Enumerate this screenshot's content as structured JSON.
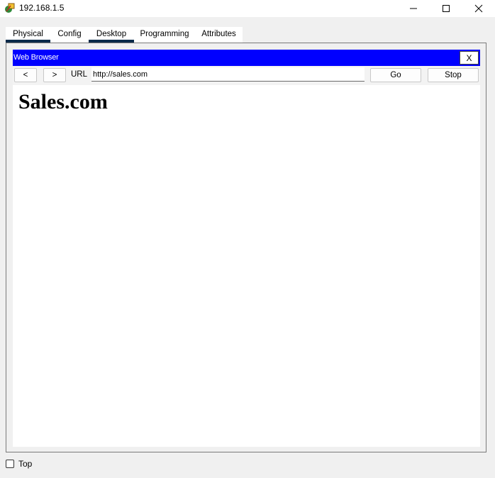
{
  "window": {
    "title": "192.168.1.5",
    "icon": "packet-tracer-pc-icon"
  },
  "tabs": [
    {
      "label": "Physical",
      "selected": true
    },
    {
      "label": "Config",
      "selected": false
    },
    {
      "label": "Desktop",
      "selected": true
    },
    {
      "label": "Programming",
      "selected": false
    },
    {
      "label": "Attributes",
      "selected": false
    }
  ],
  "browser": {
    "title": "Web Browser",
    "close_label": "X",
    "back_label": "<",
    "forward_label": ">",
    "url_label": "URL",
    "url_value": "http://sales.com",
    "go_label": "Go",
    "stop_label": "Stop",
    "title_bar_color": "#0000ff",
    "page": {
      "heading": "Sales.com"
    }
  },
  "footer": {
    "top_label": "Top",
    "top_checked": false
  }
}
